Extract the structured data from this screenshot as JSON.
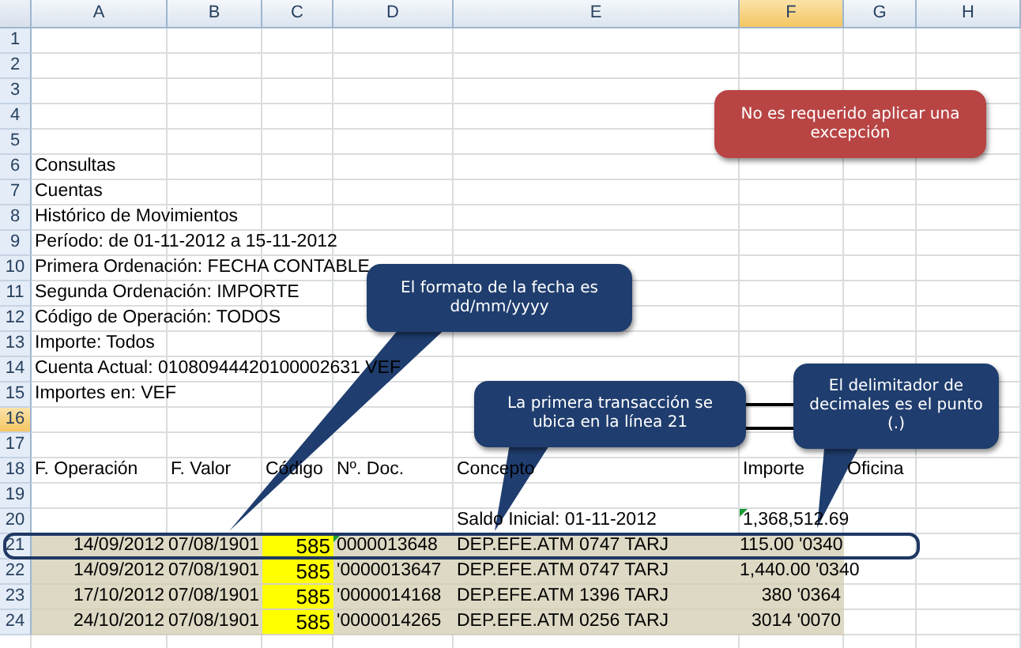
{
  "columns": [
    {
      "label": "A",
      "selected": false
    },
    {
      "label": "B",
      "selected": false
    },
    {
      "label": "C",
      "selected": false
    },
    {
      "label": "D",
      "selected": false
    },
    {
      "label": "E",
      "selected": false
    },
    {
      "label": "F",
      "selected": true
    },
    {
      "label": "G",
      "selected": false
    },
    {
      "label": "H",
      "selected": false
    }
  ],
  "rows": [
    {
      "number": "1",
      "selected": false,
      "kind": "text",
      "outlined": false
    },
    {
      "number": "2",
      "selected": false,
      "kind": "text",
      "outlined": false
    },
    {
      "number": "3",
      "selected": false,
      "kind": "text",
      "outlined": false
    },
    {
      "number": "4",
      "selected": false,
      "kind": "text",
      "outlined": false
    },
    {
      "number": "5",
      "selected": false,
      "kind": "text",
      "outlined": false
    },
    {
      "number": "6",
      "selected": false,
      "kind": "text",
      "outlined": false,
      "A": {
        "text": "Consultas"
      }
    },
    {
      "number": "7",
      "selected": false,
      "kind": "text",
      "outlined": false,
      "A": {
        "text": "Cuentas"
      }
    },
    {
      "number": "8",
      "selected": false,
      "kind": "text",
      "outlined": false,
      "A": {
        "text": "Histórico de Movimientos"
      }
    },
    {
      "number": "9",
      "selected": false,
      "kind": "text",
      "outlined": false,
      "A": {
        "text": "Período:  de 01-11-2012 a 15-11-2012"
      }
    },
    {
      "number": "10",
      "selected": false,
      "kind": "text",
      "outlined": false,
      "A": {
        "text": "Primera Ordenación: FECHA CONTABLE"
      }
    },
    {
      "number": "11",
      "selected": false,
      "kind": "text",
      "outlined": false,
      "A": {
        "text": "Segunda Ordenación: IMPORTE"
      }
    },
    {
      "number": "12",
      "selected": false,
      "kind": "text",
      "outlined": false,
      "A": {
        "text": "Código de Operación: TODOS"
      }
    },
    {
      "number": "13",
      "selected": false,
      "kind": "text",
      "outlined": false,
      "A": {
        "text": "Importe: Todos"
      }
    },
    {
      "number": "14",
      "selected": false,
      "kind": "text",
      "outlined": false,
      "A": {
        "text": "Cuenta Actual: 01080944420100002631 VEF"
      }
    },
    {
      "number": "15",
      "selected": false,
      "kind": "text",
      "outlined": false,
      "A": {
        "text": "Importes en: VEF"
      }
    },
    {
      "number": "16",
      "selected": true,
      "kind": "text",
      "outlined": false
    },
    {
      "number": "17",
      "selected": false,
      "kind": "text",
      "outlined": false
    },
    {
      "number": "18",
      "selected": false,
      "kind": "text",
      "outlined": false,
      "A": {
        "text": "F. Operación"
      },
      "B": {
        "text": "F. Valor"
      },
      "C": {
        "text": "Código"
      },
      "D": {
        "text": "Nº. Doc."
      },
      "E": {
        "text": "Concepto"
      },
      "F": {
        "text": "Importe"
      },
      "G": {
        "text": "Oficina"
      }
    },
    {
      "number": "19",
      "selected": false,
      "kind": "text",
      "outlined": false
    },
    {
      "number": "20",
      "selected": false,
      "kind": "text",
      "outlined": false,
      "E": {
        "text": "Saldo Inicial: 01-11-2012"
      },
      "F": {
        "text": "1,368,512.69",
        "warning": true
      }
    },
    {
      "number": "21",
      "selected": false,
      "kind": "transaction",
      "outlined": true,
      "A": {
        "text": "14/09/2012",
        "color": "#ddd9c4"
      },
      "B": {
        "text": "07/08/1901",
        "color": "#ddd9c4"
      },
      "C": {
        "text": "585",
        "color": "#ffff00"
      },
      "D": {
        "text": "0000013648",
        "color": "#ddd9c4",
        "warning": true
      },
      "E": {
        "text": "DEP.EFE.ATM 0747 TARJ",
        "color": "#ddd9c4"
      },
      "F": {
        "text": "115.00 '0340",
        "color": "#ddd9c4"
      }
    },
    {
      "number": "22",
      "selected": false,
      "kind": "transaction",
      "outlined": false,
      "A": {
        "text": "14/09/2012",
        "color": "#ddd9c4"
      },
      "B": {
        "text": "07/08/1901",
        "color": "#ddd9c4"
      },
      "C": {
        "text": "585",
        "color": "#ffff00"
      },
      "D": {
        "text": "'0000013647",
        "color": "#ddd9c4"
      },
      "E": {
        "text": "DEP.EFE.ATM 0747 TARJ",
        "color": "#ddd9c4"
      },
      "F": {
        "text": "1,440.00 '0340",
        "color": "#ddd9c4"
      }
    },
    {
      "number": "23",
      "selected": false,
      "kind": "transaction",
      "outlined": false,
      "A": {
        "text": "17/10/2012",
        "color": "#ddd9c4"
      },
      "B": {
        "text": "07/08/1901",
        "color": "#ddd9c4"
      },
      "C": {
        "text": "585",
        "color": "#ffff00"
      },
      "D": {
        "text": "'0000014168",
        "color": "#ddd9c4"
      },
      "E": {
        "text": "DEP.EFE.ATM 1396 TARJ",
        "color": "#ddd9c4"
      },
      "F": {
        "text": "380 '0364",
        "color": "#ddd9c4"
      }
    },
    {
      "number": "24",
      "selected": false,
      "kind": "transaction",
      "outlined": false,
      "A": {
        "text": "24/10/2012",
        "color": "#ddd9c4"
      },
      "B": {
        "text": "07/08/1901",
        "color": "#ddd9c4"
      },
      "C": {
        "text": "585",
        "color": "#ffff00"
      },
      "D": {
        "text": "'0000014265",
        "color": "#ddd9c4"
      },
      "E": {
        "text": "DEP.EFE.ATM 0256 TARJ",
        "color": "#ddd9c4"
      },
      "F": {
        "text": "3014 '0070",
        "color": "#ddd9c4"
      }
    }
  ],
  "callouts": [
    {
      "text": "No es requerido aplicar una excepción",
      "color": "#b94444"
    },
    {
      "text": "El formato de la fecha es dd/mm/yyyy",
      "color": "#1f3d6e"
    },
    {
      "text": "La primera transacción se ubica en la línea 21",
      "color": "#1f3d6e"
    },
    {
      "text": "El delimitador de decimales es el punto (.)",
      "color": "#1f3d6e"
    }
  ]
}
